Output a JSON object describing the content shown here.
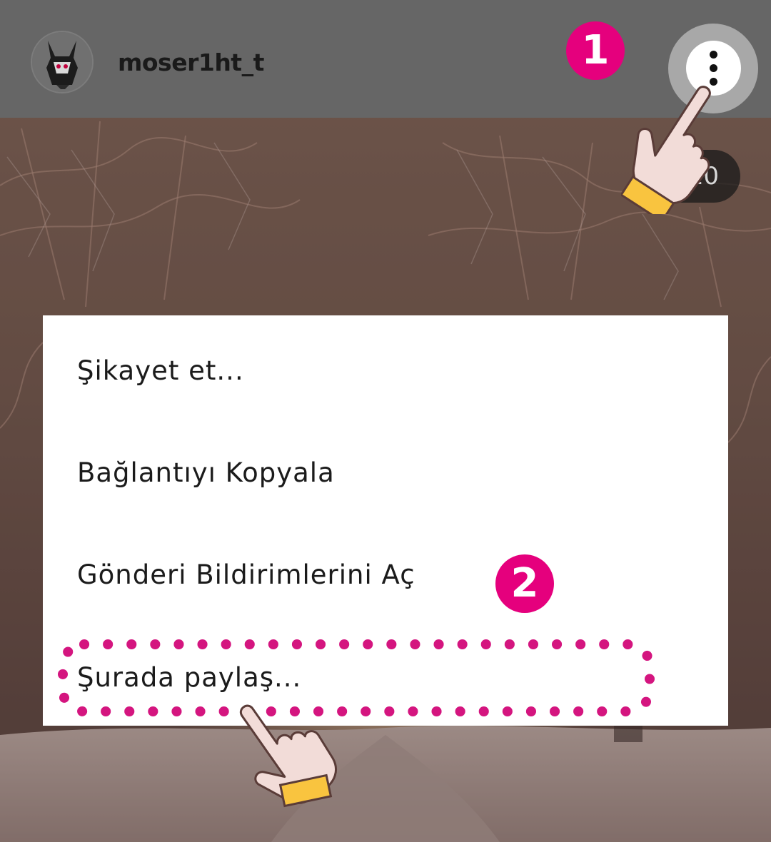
{
  "header": {
    "username": "moser1ht_t",
    "more_options_label": "More options"
  },
  "post": {
    "image_counter": "1/10"
  },
  "menu": {
    "items": [
      {
        "label": "Şikayet et..."
      },
      {
        "label": "Bağlantıyı Kopyala"
      },
      {
        "label": "Gönderi Bildirimlerini Aç"
      },
      {
        "label": "Şurada paylaş..."
      }
    ]
  },
  "annotations": {
    "step_1": "1",
    "step_2": "2",
    "accent_color": "#e5007d",
    "cuff_color": "#f9c43f"
  }
}
